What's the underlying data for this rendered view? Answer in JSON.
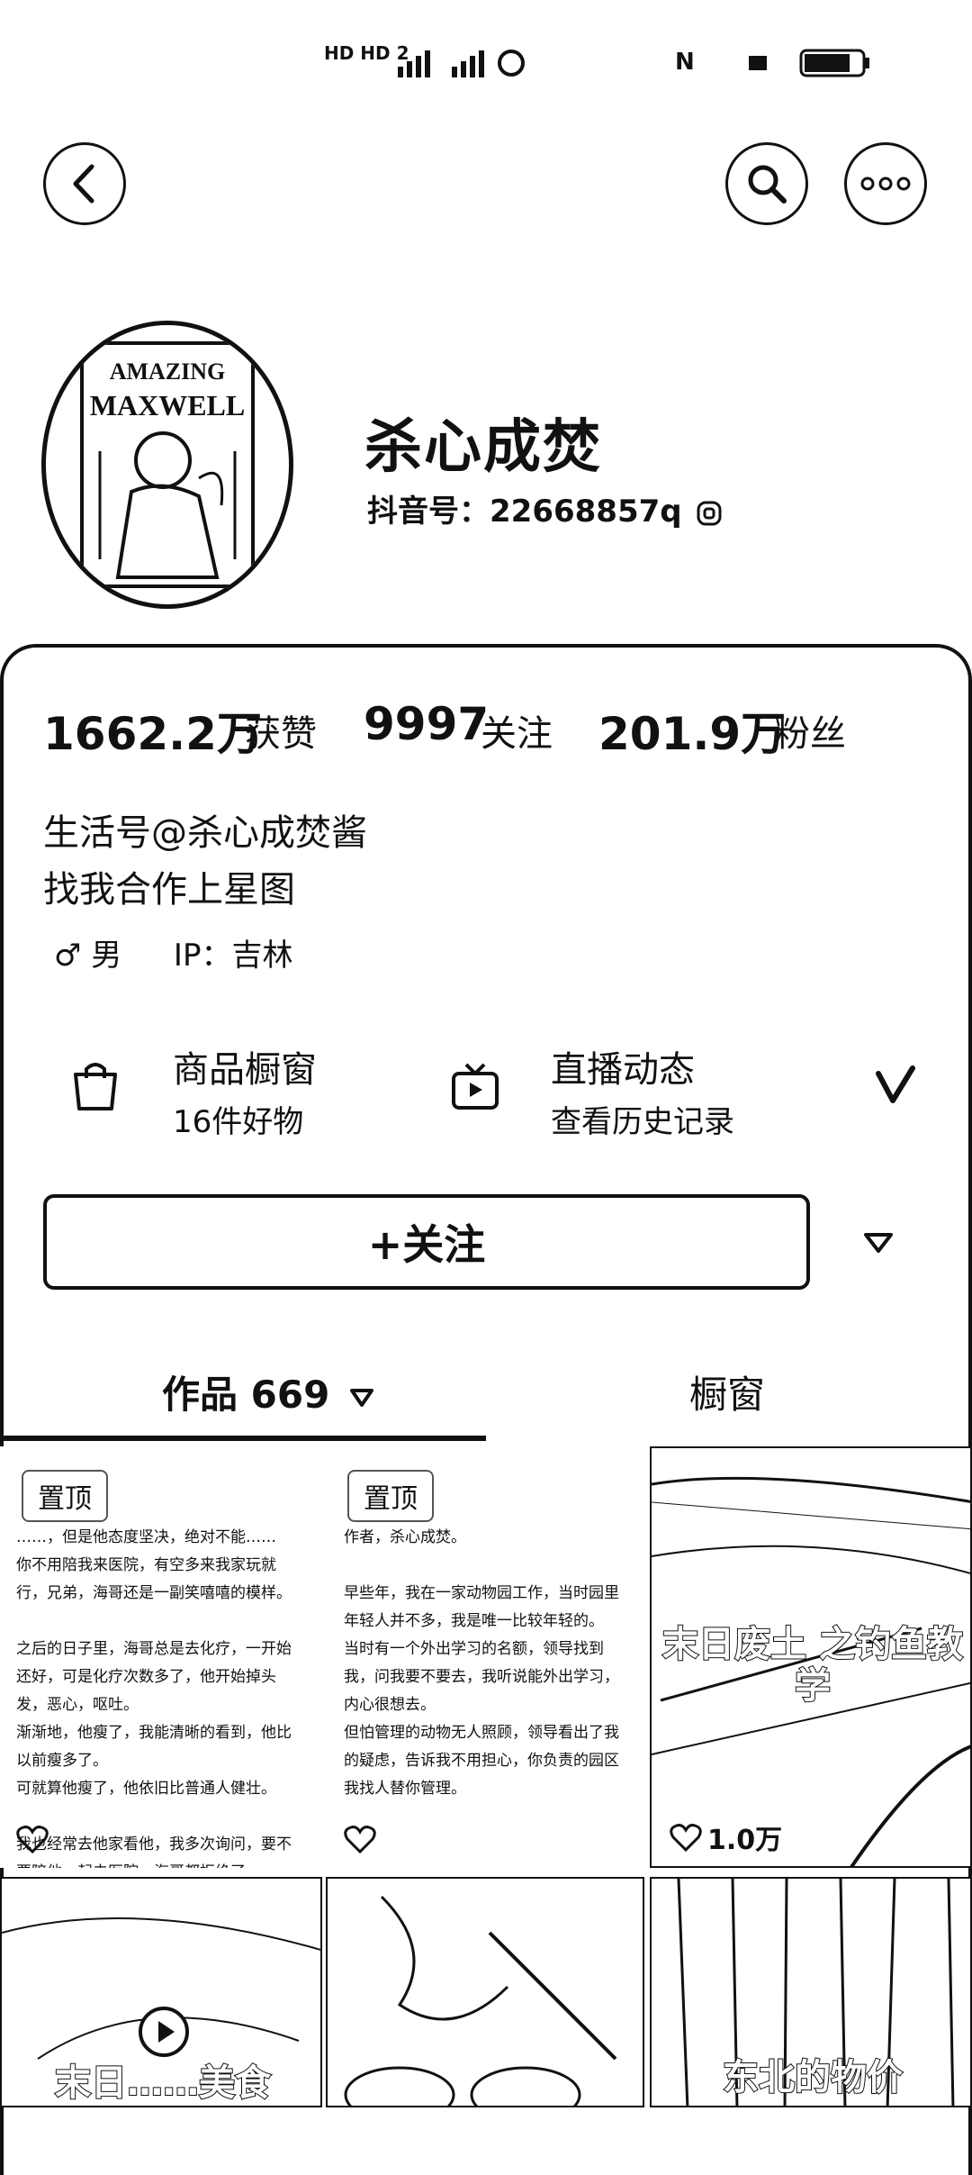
{
  "status_bar": {
    "left_text": "HD  HD 2",
    "right_text": "N"
  },
  "header": {
    "back_icon": "chevron-left-icon",
    "search_icon": "search-icon",
    "more_icon": "ellipsis-icon"
  },
  "profile": {
    "name": "杀心成焚",
    "douyin_id": "抖音号：22668857q",
    "avatar_title_1": "AMAZING",
    "avatar_title_2": "MAXWELL"
  },
  "stats": [
    {
      "value": "1662.2万",
      "label": "获赞"
    },
    {
      "value": "9997",
      "label": "关注"
    },
    {
      "value": "201.9万",
      "label": "粉丝"
    }
  ],
  "bio": {
    "line1": "生活号@杀心成焚酱",
    "line2": "找我合作上星图"
  },
  "meta": {
    "gender": "♂ 男",
    "ip": "IP：吉林"
  },
  "services": [
    {
      "title": "商品橱窗",
      "subtitle": "16件好物",
      "icon": "shopping-bag-icon"
    },
    {
      "title": "直播动态",
      "subtitle": "查看历史记录",
      "icon": "tv-icon"
    }
  ],
  "follow_button": "+关注",
  "tabs": {
    "works": "作品 669",
    "showcase": "橱窗"
  },
  "grid": {
    "pin_label": "置顶",
    "tile1_text": "……，但是他态度坚决，绝对不能……\n你不用陪我来医院，有空多来我家玩就行，兄弟，海哥还是一副笑嘻嘻的模样。\n\n之后的日子里，海哥总是去化疗，一开始还好，可是化疗次数多了，他开始掉头发，恶心，呕吐。\n渐渐地，他瘦了，我能清晰的看到，他比以前瘦多了。\n可就算他瘦了，他依旧比普通人健壮。\n\n我也经常去他家看他，我多次询问，要不要陪他一起去医院，海哥都拒绝了。\n……的药水，在渐渐地侵蚀他的血肉。",
    "tile2_text": "作者，杀心成焚。\n\n早些年，我在一家动物园工作，当时园里年轻人并不多，我是唯一比较年轻的。\n当时有一个外出学习的名额，领导找到我，问我要不要去，我听说能外出学习，内心很想去。\n但怕管理的动物无人照顾，领导看出了我的疑虑，告诉我不用担心，你负责的园区我找人替你管理。",
    "tile3_title": "末日废土\n之钓鱼教学",
    "tile3_likes": "1.0万",
    "tile4_title": "末日……美食",
    "tile6_title": "东北的物价"
  }
}
